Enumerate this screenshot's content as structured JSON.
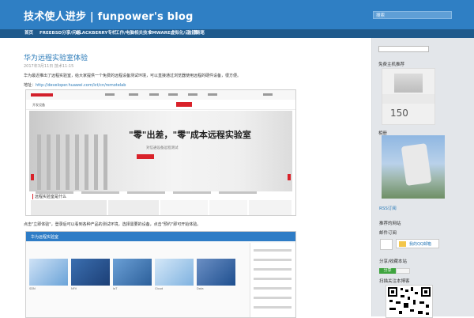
{
  "header": {
    "title": "技术使人进步 | funpower's blog",
    "search_placeholder": "搜索"
  },
  "nav": {
    "items": [
      {
        "label": "首页"
      },
      {
        "label": "FREEBSD分享/问答"
      },
      {
        "label": "BLACKBERRY专栏"
      },
      {
        "label": "工作/电脑相关技术"
      },
      {
        "label": "VMWARE虚拟化/云计算"
      },
      {
        "label": "生活随笔"
      }
    ]
  },
  "post": {
    "title": "华为远程实验室体验",
    "date": "2017年3月11日    技术11:15",
    "intro": "华为最近推出了远程实验室，给大家提供一个免费的远程设备测试环境，可以直接通过浏览器使用远程的硬件设备，很方便。",
    "link_prefix": "地址：",
    "link_text": "http://developer.huawei.com/ict/cn/remotelab",
    "second_line": "点击\"立即体验\"，登录后可以看到各种产品的测试环境，选择需要的设备，点击\"预约\"即可开始体验。"
  },
  "shot1": {
    "headline": "\"零\"出差，\"零\"成本远程实验室",
    "subline": "对信通设备远程测试",
    "section": "远程实验室是什么",
    "sublabel": "开发设备"
  },
  "shot2": {
    "bar_title": "华为远程实验室",
    "card_labels": [
      "SDN",
      "NFV",
      "IoT",
      "Cloud",
      "Data"
    ]
  },
  "sidebar": {
    "search_label": "",
    "photo1_title": "免费主机推荐",
    "photo1_price": "150",
    "photo2_title": "相册",
    "link_rss": "RSS订阅",
    "section_friends": "推荐的网站",
    "section_mail": "邮件订阅",
    "qq_mail": "我的QQ邮箱",
    "section_share": "分享/收藏本站",
    "share_label": "分享",
    "section_qr": "扫描关注本博客"
  }
}
